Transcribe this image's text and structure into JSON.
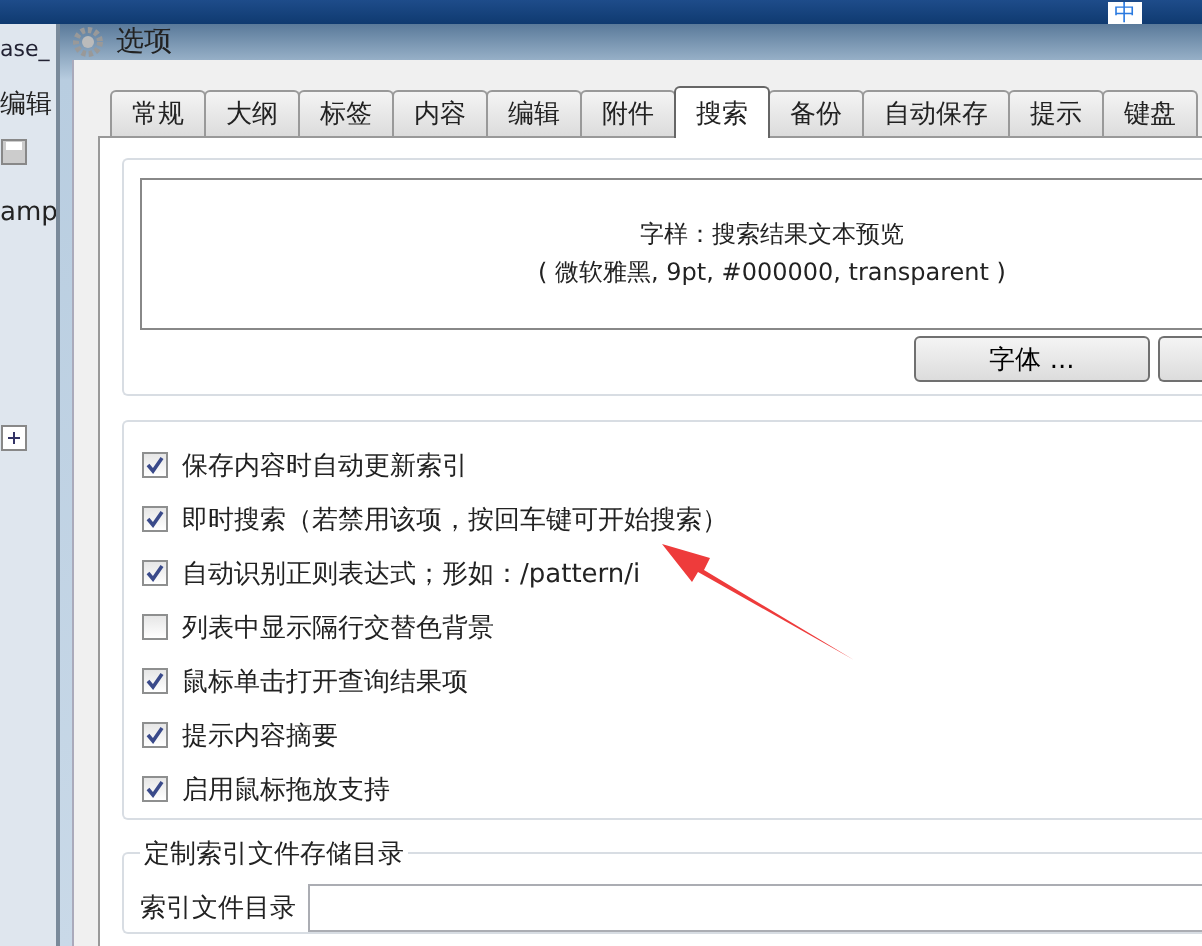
{
  "taskbar": {
    "tray_text": "中"
  },
  "background_window": {
    "title": "ase_",
    "menu": "编辑",
    "tab": "amp"
  },
  "dialog": {
    "title": "选项",
    "tabs": [
      {
        "label": "常规",
        "selected": false
      },
      {
        "label": "大纲",
        "selected": false
      },
      {
        "label": "标签",
        "selected": false
      },
      {
        "label": "内容",
        "selected": false
      },
      {
        "label": "编辑",
        "selected": false
      },
      {
        "label": "附件",
        "selected": false
      },
      {
        "label": "搜索",
        "selected": true
      },
      {
        "label": "备份",
        "selected": false
      },
      {
        "label": "自动保存",
        "selected": false
      },
      {
        "label": "提示",
        "selected": false
      },
      {
        "label": "键盘",
        "selected": false
      }
    ],
    "preview": {
      "line_1": "字样：搜索结果文本预览",
      "line_2": "( 微软雅黑, 9pt, #000000, transparent )"
    },
    "buttons": [
      "字体 ..."
    ],
    "options": [
      {
        "label": "保存内容时自动更新索引",
        "checked": true
      },
      {
        "label": "即时搜索（若禁用该项，按回车键可开始搜索）",
        "checked": true
      },
      {
        "label": "自动识别正则表达式；形如：/pattern/i",
        "checked": true
      },
      {
        "label": "列表中显示隔行交替色背景",
        "checked": false
      },
      {
        "label": "鼠标单击打开查询结果项",
        "checked": true
      },
      {
        "label": "提示内容摘要",
        "checked": true
      },
      {
        "label": "启用鼠标拖放支持",
        "checked": true
      }
    ],
    "index_dir": {
      "group_title": "定制索引文件存储目录",
      "label": "索引文件目录"
    }
  }
}
